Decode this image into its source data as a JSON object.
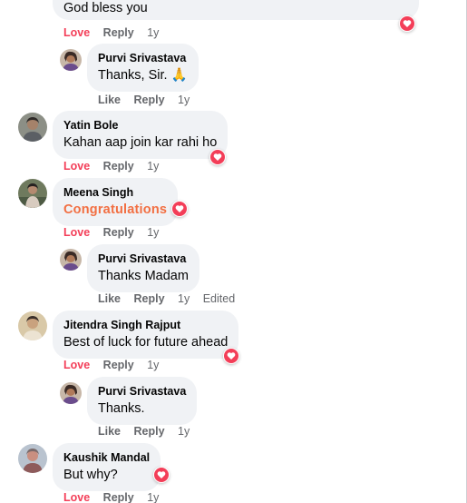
{
  "colors": {
    "love": "#f33e58",
    "bubble": "#f0f2f5",
    "meta": "#65676b",
    "congrats": "#f26f42"
  },
  "comments": [
    {
      "text": "God bless you",
      "reaction": "heart-icon",
      "actions": {
        "love": "Love",
        "reply": "Reply",
        "time": "1y"
      }
    },
    {
      "author": "Purvi Srivastava",
      "text": "Thanks, Sir. 🙏",
      "actions": {
        "like": "Like",
        "reply": "Reply",
        "time": "1y"
      }
    },
    {
      "author": "Yatin Bole",
      "text": "Kahan aap join kar rahi ho",
      "reaction": "heart-icon",
      "actions": {
        "love": "Love",
        "reply": "Reply",
        "time": "1y"
      }
    },
    {
      "author": "Meena Singh",
      "text": "Congratulations",
      "reaction": "heart-icon",
      "actions": {
        "love": "Love",
        "reply": "Reply",
        "time": "1y"
      }
    },
    {
      "author": "Purvi Srivastava",
      "text": "Thanks Madam",
      "actions": {
        "like": "Like",
        "reply": "Reply",
        "time": "1y",
        "edited": "Edited"
      }
    },
    {
      "author": "Jitendra Singh Rajput",
      "text": "Best of luck for future ahead",
      "reaction": "heart-icon",
      "actions": {
        "love": "Love",
        "reply": "Reply",
        "time": "1y"
      }
    },
    {
      "author": "Purvi Srivastava",
      "text": "Thanks.",
      "actions": {
        "like": "Like",
        "reply": "Reply",
        "time": "1y"
      }
    },
    {
      "author": "Kaushik Mandal",
      "text": "But why?",
      "reaction": "heart-icon",
      "actions": {
        "love": "Love",
        "reply": "Reply",
        "time": "1y"
      }
    }
  ]
}
